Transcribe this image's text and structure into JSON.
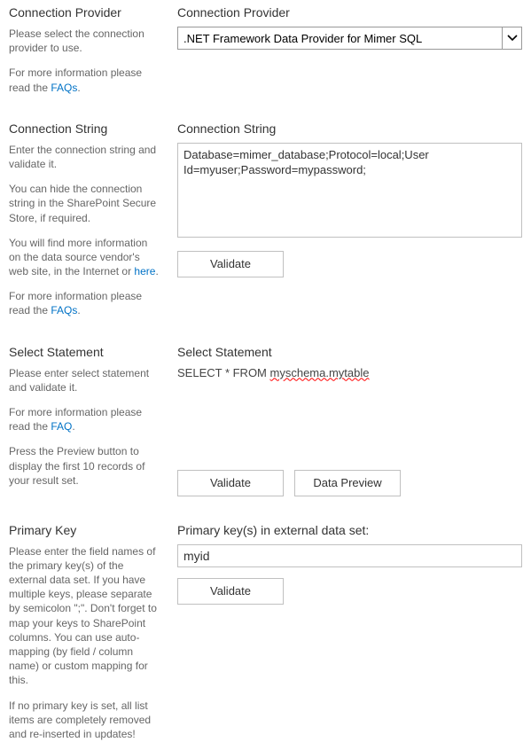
{
  "provider": {
    "sideHeading": "Connection Provider",
    "sideDesc": "Please select the connection provider to use.",
    "sideMoreInfo": "For more information please read the ",
    "sideFaqs": "FAQs",
    "period": ".",
    "label": "Connection Provider",
    "value": ".NET Framework Data Provider for Mimer SQL"
  },
  "connString": {
    "sideHeading": "Connection String",
    "sideDesc1": "Enter the connection string and validate it.",
    "sideDesc2a": "You can hide the connection string in the SharePoint Secure Store, if required.",
    "sideDesc3a": "You will find more information on the data source vendor's web site, in the Internet or ",
    "hereLink": "here",
    "sideMoreInfo": "For more information please read the ",
    "sideFaqs": "FAQs",
    "period": ".",
    "label": "Connection String",
    "value": "Database=mimer_database;Protocol=local;User Id=myuser;Password=mypassword;",
    "validateBtn": "Validate"
  },
  "selectStmt": {
    "sideHeading": "Select Statement",
    "sideDesc1": "Please enter select statement and validate it.",
    "sideMoreInfo": "For more information please read the ",
    "sideFaq": "FAQ",
    "period": ".",
    "sideDesc3": "Press the Preview button to display the first 10 records of your result set.",
    "label": "Select Statement",
    "valuePrefix": "SELECT * FROM ",
    "valueSquiggle": "myschema.mytable",
    "validateBtn": "Validate",
    "previewBtn": "Data Preview"
  },
  "primaryKey": {
    "sideHeading": "Primary Key",
    "sideDesc1": "Please enter the field names of the primary key(s) of the external data set. If you have multiple keys, please separate by semicolon \";\". Don't forget to map your keys to SharePoint columns. You can use auto-mapping (by field / column name) or custom mapping for this.",
    "sideDesc2": "If no primary key is set, all list items are completely removed and re-inserted in updates!",
    "label": "Primary key(s) in external data set:",
    "value": "myid",
    "validateBtn": "Validate"
  }
}
